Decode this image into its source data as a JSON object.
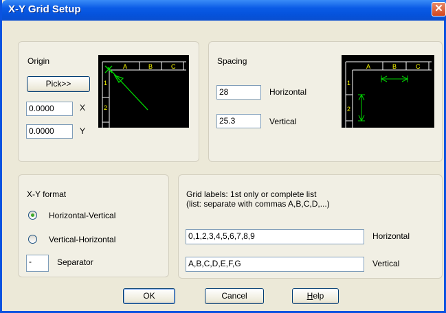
{
  "window": {
    "title": "X-Y Grid Setup",
    "close_glyph": "✕"
  },
  "origin": {
    "label": "Origin",
    "pick_button": "Pick>>",
    "x_value": "0.0000",
    "x_label": "X",
    "y_value": "0.0000",
    "y_label": "Y",
    "preview": {
      "cols": [
        "A",
        "B",
        "C"
      ],
      "rows": [
        "1",
        "2"
      ]
    }
  },
  "spacing": {
    "label": "Spacing",
    "horizontal_value": "28",
    "horizontal_label": "Horizontal",
    "vertical_value": "25.3",
    "vertical_label": "Vertical",
    "preview": {
      "cols": [
        "A",
        "B",
        "C"
      ],
      "rows": [
        "1",
        "2"
      ]
    }
  },
  "xy_format": {
    "label": "X-Y format",
    "options": [
      "Horizontal-Vertical",
      "Vertical-Horizontal"
    ],
    "selected": "Horizontal-Vertical",
    "separator_value": "-",
    "separator_label": "Separator"
  },
  "grid_labels": {
    "line1": "Grid labels: 1st only or complete list",
    "line2": "(list: separate with commas A,B,C,D,...)",
    "horizontal_value": "0,1,2,3,4,5,6,7,8,9",
    "horizontal_label": "Horizontal",
    "vertical_value": "A,B,C,D,E,F,G",
    "vertical_label": "Vertical"
  },
  "buttons": {
    "ok": "OK",
    "cancel": "Cancel",
    "help_first": "H",
    "help_rest": "elp"
  },
  "colors": {
    "titlebar": "#0a5be6",
    "preview_green": "#00d200",
    "preview_yellow": "#ffff00"
  }
}
